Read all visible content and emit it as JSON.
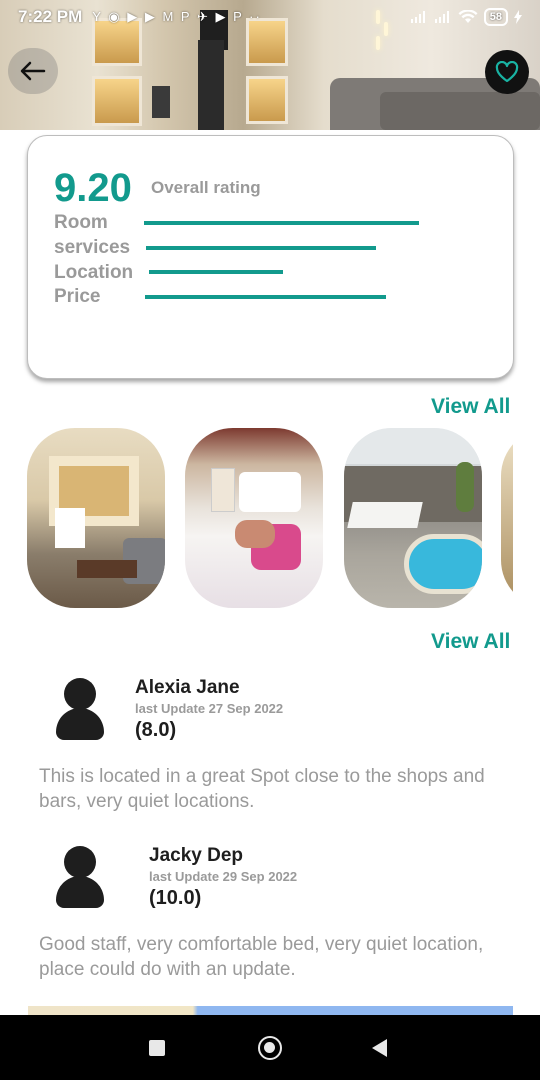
{
  "status_bar": {
    "time": "7:22 PM",
    "left_icons": "Y ◉ ▶ ▶ M P ✈ ▶ P ··",
    "battery": "58"
  },
  "rating": {
    "overall_score": "9.20",
    "overall_label": "Overall rating",
    "criteria": [
      {
        "label": "Room",
        "level": 0.8
      },
      {
        "label": "services",
        "level": 0.67
      },
      {
        "label": "Location",
        "level": 0.39
      },
      {
        "label": "Price",
        "level": 0.7
      }
    ]
  },
  "gallery": {
    "view_all_label": "View All"
  },
  "reviews": {
    "view_all_label": "View All",
    "items": [
      {
        "name": "Alexia Jane",
        "date": "last Update 27 Sep 2022",
        "score": "(8.0)",
        "text": "This is located in a great Spot close to the shops and bars, very quiet locations."
      },
      {
        "name": "Jacky Dep",
        "date": "last Update 29 Sep 2022",
        "score": "(10.0)",
        "text": "Good staff, very comfortable bed, very quiet location, place could do with an update."
      }
    ]
  },
  "colors": {
    "accent": "#129a8d",
    "muted_text": "#9a9a9a",
    "dark_text": "#1e1e1e"
  },
  "icons": {
    "back": "arrow-left-icon",
    "favorite": "heart-icon",
    "avatar": "person-icon"
  }
}
